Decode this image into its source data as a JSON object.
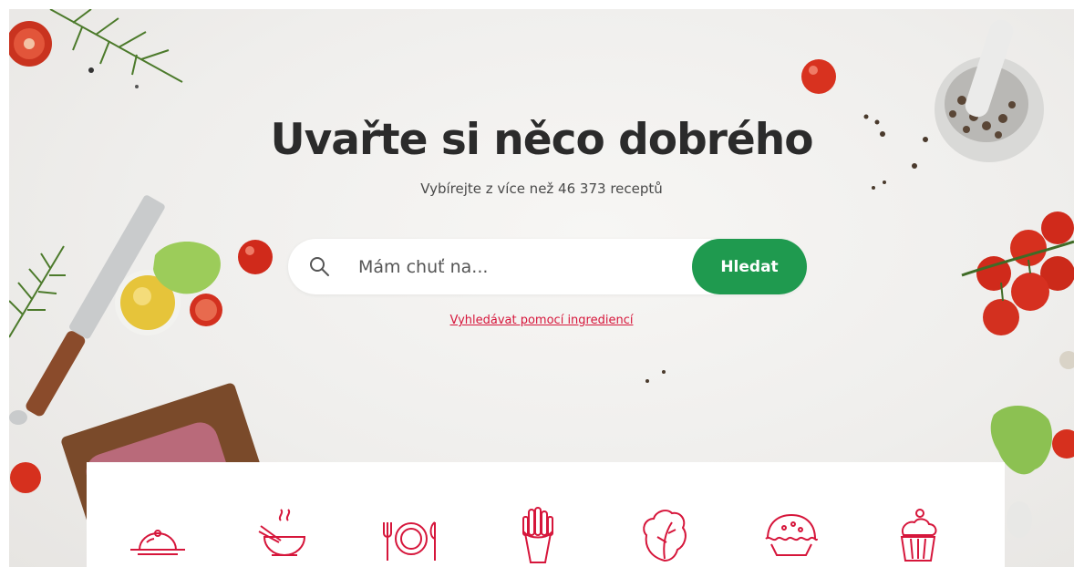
{
  "hero": {
    "title": "Uvařte si něco dobrého",
    "subtitle": "Vybírejte z více než 46 373 receptů"
  },
  "search": {
    "placeholder": "Mám chuť na...",
    "button_label": "Hledat",
    "icon": "search-icon"
  },
  "ingredients_link": "Vyhledávat pomocí ingrediencí",
  "categories": [
    {
      "icon": "serving-dish-icon"
    },
    {
      "icon": "hot-bowl-icon"
    },
    {
      "icon": "plate-cutlery-icon"
    },
    {
      "icon": "fries-icon"
    },
    {
      "icon": "lettuce-icon"
    },
    {
      "icon": "pie-icon"
    },
    {
      "icon": "cupcake-icon"
    }
  ],
  "colors": {
    "brand_green": "#1f9a4f",
    "accent_red": "#d6163b",
    "title": "#2b2b2b",
    "background": "#efeeec"
  }
}
